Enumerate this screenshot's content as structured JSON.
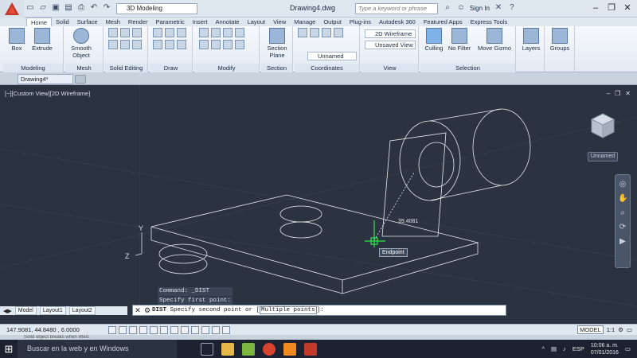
{
  "titlebar": {
    "workspace": "3D Modeling",
    "title": "Drawing4.dwg",
    "search_placeholder": "Type a keyword or phrase",
    "sign_in": "Sign In"
  },
  "ribbon_tabs": [
    "Home",
    "Solid",
    "Surface",
    "Mesh",
    "Render",
    "Parametric",
    "Insert",
    "Annotate",
    "Layout",
    "View",
    "Manage",
    "Output",
    "Plug-ins",
    "Autodesk 360",
    "Featured Apps",
    "Express Tools"
  ],
  "ribbon": {
    "box": "Box",
    "extrude": "Extrude",
    "smooth_object": "Smooth Object",
    "section_plane": "Section Plane",
    "visual_style": "2D Wireframe",
    "saved_view": "Unsaved View",
    "named_ucs": "Unnamed",
    "culling": "Culling",
    "no_filter": "No Filter",
    "move_gizmo": "Move Gizmo",
    "layers": "Layers",
    "groups": "Groups",
    "panels": {
      "modeling": "Modeling",
      "mesh": "Mesh",
      "solid_editing": "Solid Editing",
      "draw": "Draw",
      "modify": "Modify",
      "section": "Section",
      "coordinates": "Coordinates",
      "view": "View",
      "selection": "Selection"
    }
  },
  "document": {
    "tab": "Drawing4*"
  },
  "viewport": {
    "label": "[−][Custom View][2D Wireframe]",
    "viewcube_label": "Unnamed",
    "dimension": "39.4081",
    "tooltip": "Endpoint",
    "axis_x": "X",
    "axis_y": "Y",
    "axis_z": "Z"
  },
  "command_history": [
    "Command: _DIST",
    "Specify first point:"
  ],
  "command_line": {
    "prompt_cmd": "DIST",
    "prompt_text": " Specify second point or [",
    "option": "Multiple points",
    "prompt_end": "]:"
  },
  "layout_tabs": [
    "Model",
    "Layout1",
    "Layout2"
  ],
  "statusbar": {
    "coords": "147.9081, 44.8480 , 6.0000",
    "model": "MODEL",
    "scale": "1:1"
  },
  "status_sliver": "Solid object breaks when lifted.",
  "taskbar": {
    "search": "Buscar en la web y en Windows",
    "lang": "ESP",
    "time": "10:06 a. m.",
    "date": "07/01/2016"
  },
  "colors": {
    "viewport_bg": "#2b3240",
    "wire": "#e8ecf2",
    "snap_marker": "#2ee84a",
    "accent": "#c0392b"
  }
}
